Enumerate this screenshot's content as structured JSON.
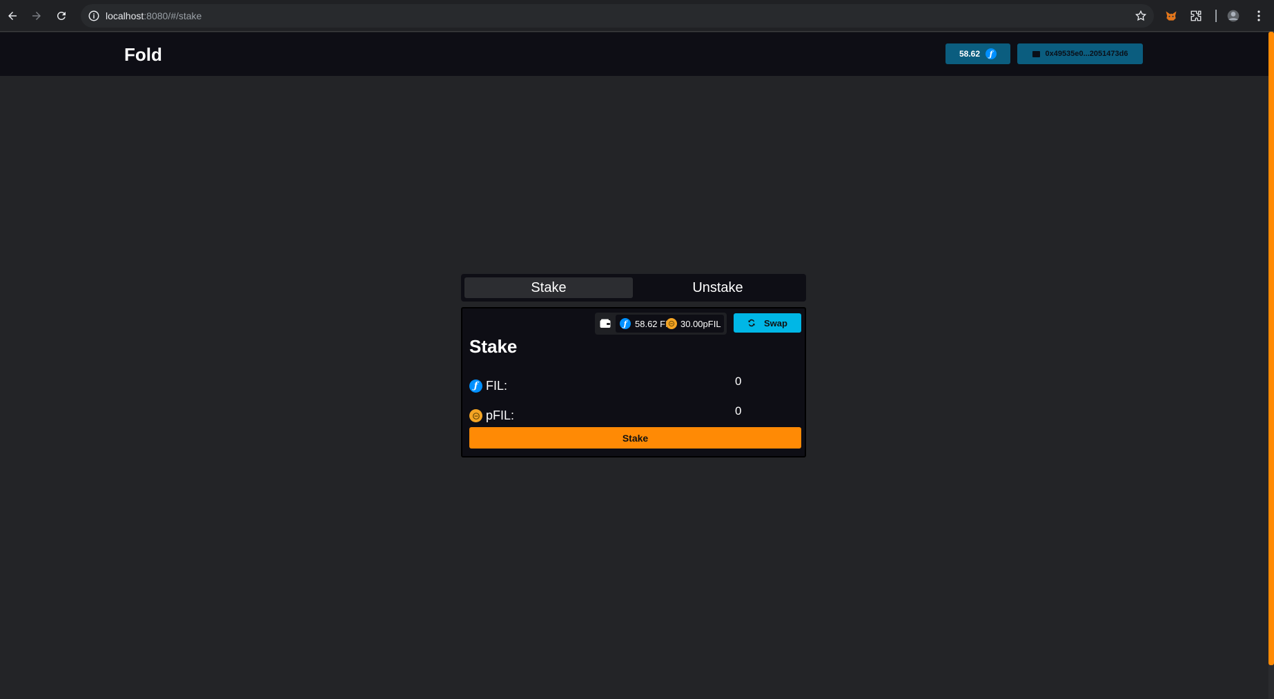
{
  "browser": {
    "url_host": "localhost",
    "url_path": ":8080/#/stake"
  },
  "header": {
    "brand": "Fold",
    "balance": "58.62",
    "address": "0x49535e0...2051473d6"
  },
  "tabs": [
    {
      "label": "Stake",
      "active": true
    },
    {
      "label": "Unstake",
      "active": false
    }
  ],
  "card": {
    "wallet_fil": "58.62 FIL",
    "wallet_pfil": "30.00pFIL",
    "swap_label": "Swap",
    "title": "Stake",
    "rows": [
      {
        "label": "FIL:",
        "value": "0",
        "icon": "fil-icon"
      },
      {
        "label": "pFIL:",
        "value": "0",
        "icon": "pfil-icon"
      }
    ],
    "stake_button": "Stake"
  },
  "colors": {
    "accent": "#ff8a05",
    "swap": "#00b7e6",
    "header_btn": "#0b5d7f",
    "fil": "#0090ff",
    "pfil": "#f5a524"
  }
}
